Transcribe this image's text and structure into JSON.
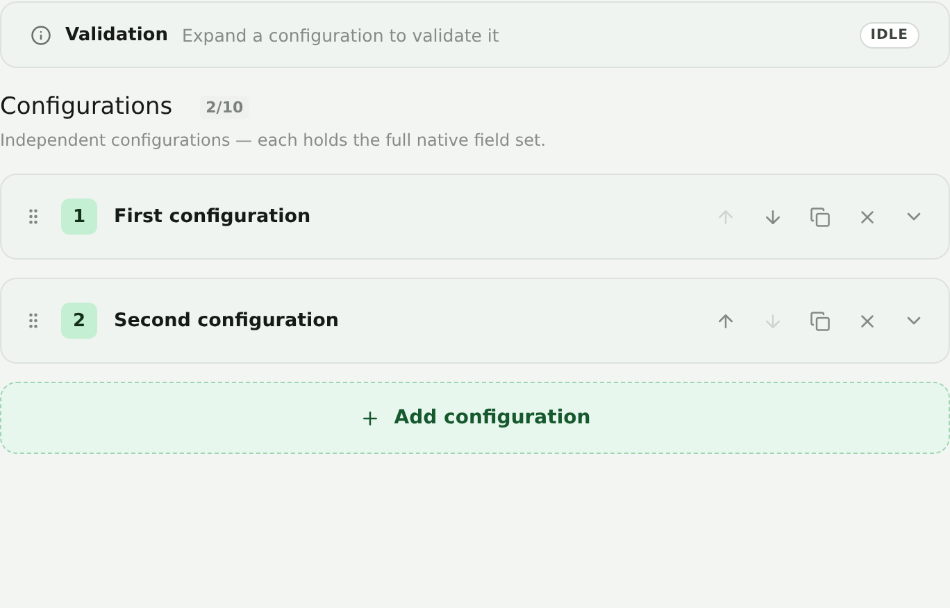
{
  "validation": {
    "title": "Validation",
    "message": "Expand a configuration to validate it",
    "status": "IDLE"
  },
  "section": {
    "title": "Configurations",
    "count": "2/10",
    "description": "Independent configurations — each holds the full native field set."
  },
  "configurations": [
    {
      "number": "1",
      "name": "First configuration",
      "move_up_disabled": true,
      "move_down_disabled": false,
      "expanded": false
    },
    {
      "number": "2",
      "name": "Second configuration",
      "move_up_disabled": false,
      "move_down_disabled": true,
      "expanded": false
    }
  ],
  "add_button": {
    "label": "Add configuration"
  }
}
